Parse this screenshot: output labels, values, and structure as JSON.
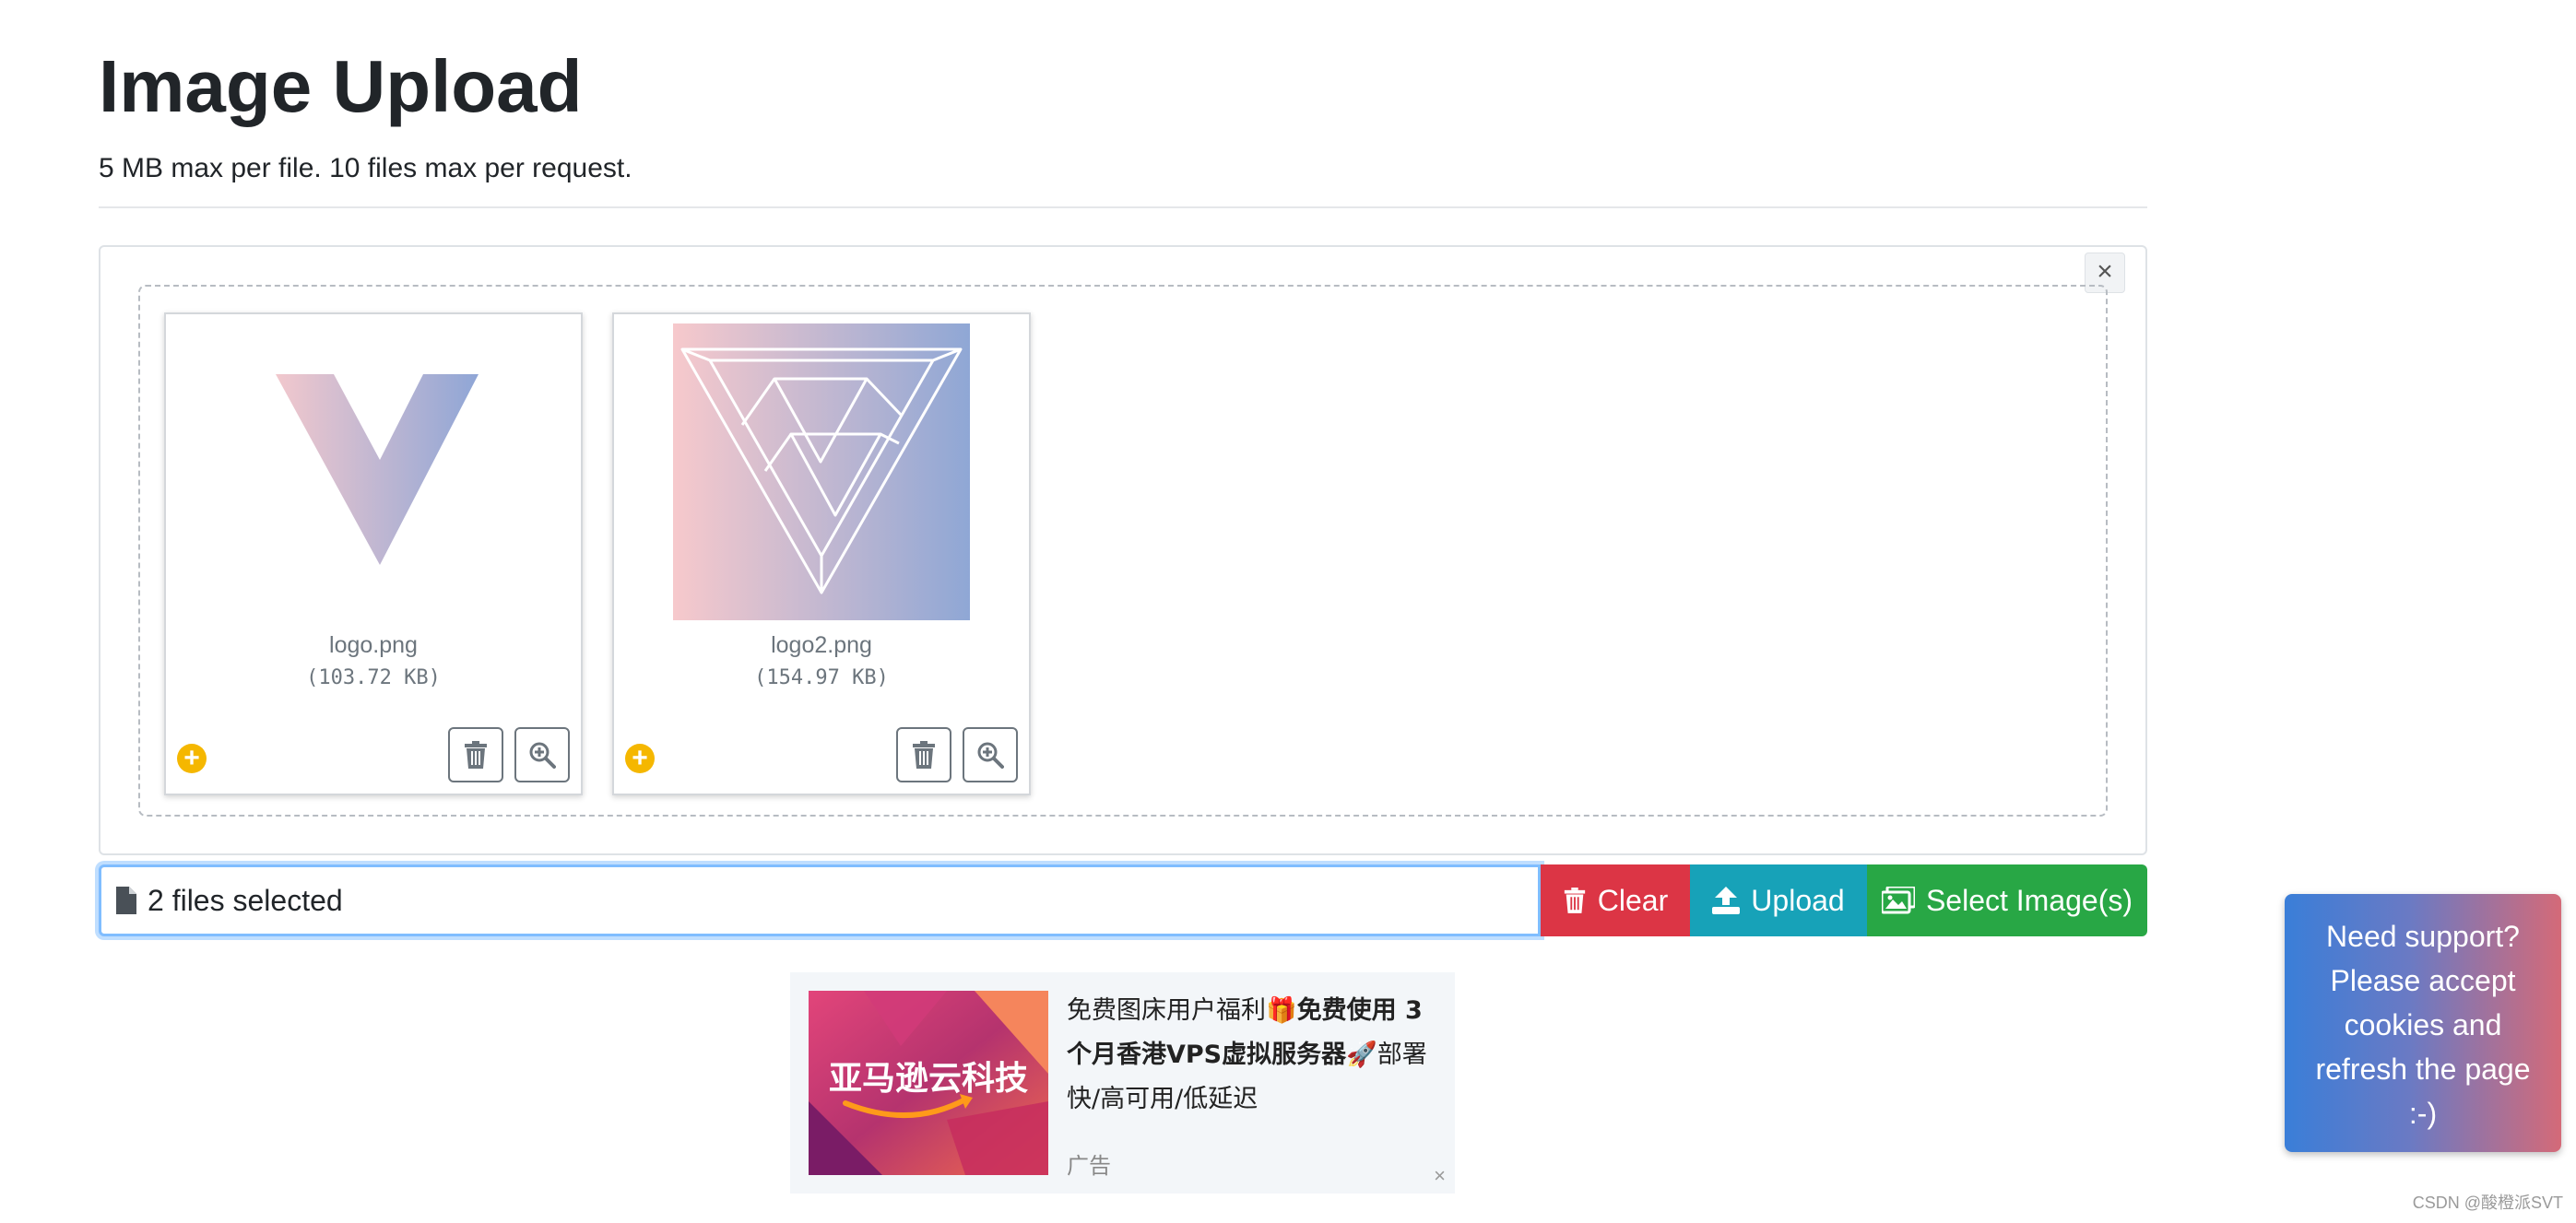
{
  "header": {
    "title": "Image Upload",
    "subtitle": "5 MB max per file. 10 files max per request."
  },
  "preview": {
    "close_label": "×",
    "files": [
      {
        "name": "logo.png",
        "size": "(103.72 KB)",
        "status_icon": "plus-circle-icon"
      },
      {
        "name": "logo2.png",
        "size": "(154.97 KB)",
        "status_icon": "plus-circle-icon"
      }
    ]
  },
  "file_input": {
    "caption": "2 files selected",
    "clear_label": "Clear",
    "upload_label": "Upload",
    "select_label": "Select Image(s)"
  },
  "ad": {
    "brand": "亚马逊云科技",
    "line_prefix": "免费图床用户福利",
    "line_bold": "免费使用 3 个月香港VPS虚拟服务器",
    "line_suffix": "部署快/高可用/低延迟",
    "label": "广告",
    "close_label": "×"
  },
  "support": {
    "message": "Need support? Please accept cookies and refresh the page :-)"
  },
  "watermark": "CSDN @酸橙派SVT",
  "colors": {
    "clear": "#dc3545",
    "upload": "#17a2b8",
    "select": "#28a745",
    "status": "#f5b700"
  }
}
